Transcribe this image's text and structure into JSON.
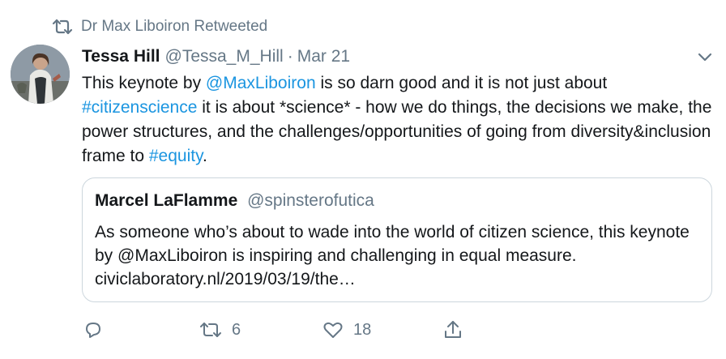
{
  "retweet_context": {
    "label": "Dr Max Liboiron Retweeted",
    "icon": "retweet-icon"
  },
  "tweet": {
    "author_name": "Tessa Hill",
    "author_handle": "@Tessa_M_Hill",
    "separator": "·",
    "date": "Mar 21",
    "text": {
      "part1": "This keynote by ",
      "mention": "@MaxLiboiron",
      "part2": " is so darn good and it is not just about ",
      "hashtag1": "#citizenscience",
      "part3": " it is about *science* - how we do things, the decisions we make, the power structures, and the challenges/opportunities of going from diversity&inclusion frame to ",
      "hashtag2": "#equity",
      "part4": "."
    }
  },
  "quoted_tweet": {
    "author_name": "Marcel LaFlamme",
    "author_handle": "@spinsterofutica",
    "text": "As someone who’s about to wade into the world of citizen science, this keynote by @MaxLiboiron is inspiring and challenging in equal measure. civiclaboratory.nl/2019/03/19/the…"
  },
  "actions": {
    "reply": {
      "icon": "reply-icon",
      "count": ""
    },
    "retweet": {
      "icon": "retweet-icon",
      "count": "6"
    },
    "like": {
      "icon": "heart-icon",
      "count": "18"
    },
    "share": {
      "icon": "share-icon",
      "count": ""
    }
  },
  "colors": {
    "link": "#1b95e0",
    "secondary_text": "#657786",
    "primary_text": "#14171a",
    "border": "#ccd6dd"
  }
}
